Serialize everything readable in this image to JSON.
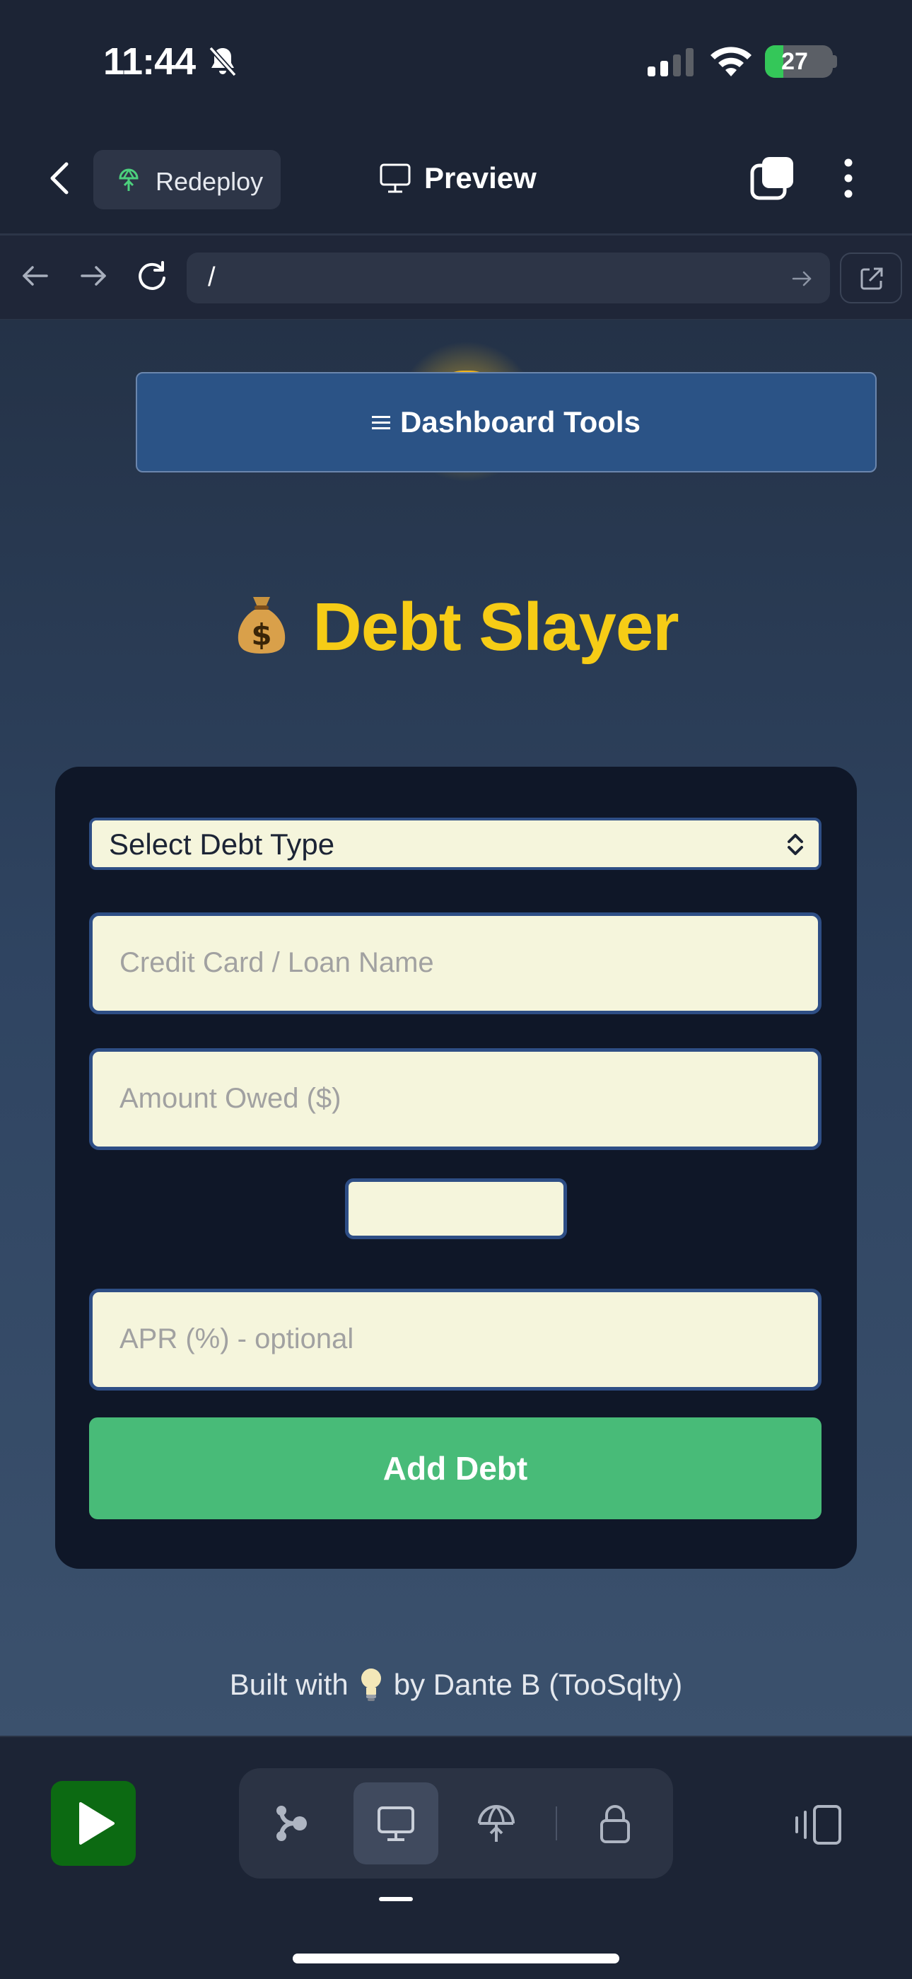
{
  "status_bar": {
    "time": "11:44",
    "battery": "27"
  },
  "topnav": {
    "redeploy_label": "Redeploy",
    "preview_label": "Preview"
  },
  "urlbar": {
    "url": "/"
  },
  "page": {
    "dashboard_button": "Dashboard Tools",
    "title": "Debt Slayer",
    "form": {
      "debt_type_select": "Select Debt Type",
      "name_placeholder": "Credit Card / Loan Name",
      "amount_placeholder": "Amount Owed ($)",
      "apr_placeholder": "APR (%) - optional",
      "add_button": "Add Debt"
    },
    "footer": {
      "prefix": "Built with",
      "suffix": "by Dante B (TooSqlty)"
    }
  },
  "icons": {
    "bell": "bell-slash-icon",
    "signal": "cellular-signal-icon",
    "wifi": "wifi-icon",
    "back": "chevron-left-icon",
    "redeploy": "tree-deploy-icon",
    "preview": "monitor-icon",
    "tabs": "tabs-icon",
    "more": "more-vertical-icon",
    "url_back": "arrow-left-icon",
    "url_forward": "arrow-right-icon",
    "reload": "reload-icon",
    "go": "arrow-right-icon",
    "external": "external-link-icon",
    "money_bag": "money-bag-icon",
    "bulb": "light-bulb-icon",
    "run": "play-icon",
    "workflow": "workflow-icon",
    "webview": "monitor-icon",
    "deploy": "deploy-icon",
    "secrets": "lock-icon",
    "device": "device-switch-icon"
  },
  "colors": {
    "title_yellow": "#f6cc16",
    "add_button_green": "#48bb78",
    "input_bg": "#f5f5dc",
    "card_bg": "#0f1728",
    "dashboard_blue": "#2b5386",
    "run_green": "#0c6a12"
  }
}
